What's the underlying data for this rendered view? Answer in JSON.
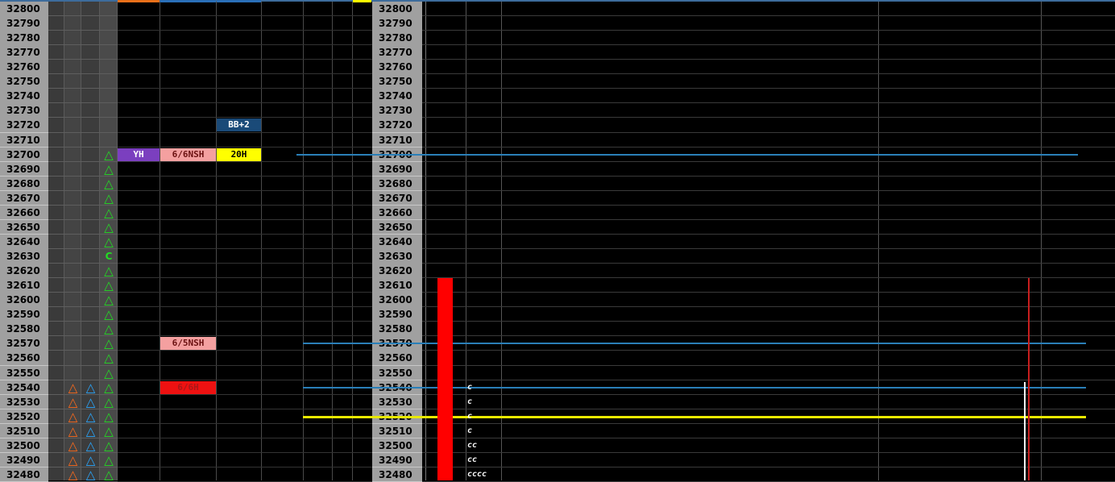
{
  "prices": [
    "32800",
    "32790",
    "32780",
    "32770",
    "32760",
    "32750",
    "32740",
    "32730",
    "32720",
    "32710",
    "32700",
    "32690",
    "32680",
    "32670",
    "32660",
    "32650",
    "32640",
    "32630",
    "32620",
    "32610",
    "32600",
    "32590",
    "32580",
    "32570",
    "32560",
    "32550",
    "32540",
    "32530",
    "32520",
    "32510",
    "32500",
    "32490",
    "32480"
  ],
  "markers": [
    {
      "price": "32700",
      "col": "green",
      "glyph": "△"
    },
    {
      "price": "32690",
      "col": "green",
      "glyph": "△"
    },
    {
      "price": "32680",
      "col": "green",
      "glyph": "△"
    },
    {
      "price": "32670",
      "col": "green",
      "glyph": "△"
    },
    {
      "price": "32660",
      "col": "green",
      "glyph": "△"
    },
    {
      "price": "32650",
      "col": "green",
      "glyph": "△"
    },
    {
      "price": "32640",
      "col": "green",
      "glyph": "△"
    },
    {
      "price": "32630",
      "col": "green",
      "glyph": "C"
    },
    {
      "price": "32620",
      "col": "green",
      "glyph": "△"
    },
    {
      "price": "32610",
      "col": "green",
      "glyph": "△"
    },
    {
      "price": "32600",
      "col": "green",
      "glyph": "△"
    },
    {
      "price": "32590",
      "col": "green",
      "glyph": "△"
    },
    {
      "price": "32580",
      "col": "green",
      "glyph": "△"
    },
    {
      "price": "32570",
      "col": "green",
      "glyph": "△"
    },
    {
      "price": "32560",
      "col": "green",
      "glyph": "△"
    },
    {
      "price": "32550",
      "col": "green",
      "glyph": "△"
    },
    {
      "price": "32540",
      "col": "green",
      "glyph": "△"
    },
    {
      "price": "32530",
      "col": "green",
      "glyph": "△"
    },
    {
      "price": "32520",
      "col": "green",
      "glyph": "△"
    },
    {
      "price": "32510",
      "col": "green",
      "glyph": "△"
    },
    {
      "price": "32500",
      "col": "green",
      "glyph": "△"
    },
    {
      "price": "32490",
      "col": "green",
      "glyph": "△"
    },
    {
      "price": "32480",
      "col": "green",
      "glyph": "△"
    },
    {
      "price": "32540",
      "col": "orange",
      "glyph": "△"
    },
    {
      "price": "32530",
      "col": "orange",
      "glyph": "△"
    },
    {
      "price": "32520",
      "col": "orange",
      "glyph": "△"
    },
    {
      "price": "32510",
      "col": "orange",
      "glyph": "△"
    },
    {
      "price": "32500",
      "col": "orange",
      "glyph": "△"
    },
    {
      "price": "32490",
      "col": "orange",
      "glyph": "△"
    },
    {
      "price": "32480",
      "col": "orange",
      "glyph": "△"
    },
    {
      "price": "32540",
      "col": "blue",
      "glyph": "△"
    },
    {
      "price": "32530",
      "col": "blue",
      "glyph": "△"
    },
    {
      "price": "32520",
      "col": "blue",
      "glyph": "△"
    },
    {
      "price": "32510",
      "col": "blue",
      "glyph": "△"
    },
    {
      "price": "32500",
      "col": "blue",
      "glyph": "△"
    },
    {
      "price": "32490",
      "col": "blue",
      "glyph": "△"
    },
    {
      "price": "32480",
      "col": "blue",
      "glyph": "△"
    }
  ],
  "marker_colors": {
    "green": "#22dd22",
    "orange": "#ff6a1a",
    "blue": "#2aa8ff"
  },
  "labels": [
    {
      "text": "BB+2",
      "price": "32720",
      "slot": "c3",
      "bg": "#1a4a78",
      "fg": "#ffffff"
    },
    {
      "text": "YH",
      "price": "32700",
      "slot": "c1",
      "bg": "#7b3fbf",
      "fg": "#ffffff"
    },
    {
      "text": "6/6NSH",
      "price": "32700",
      "slot": "c2",
      "bg": "#f4a0a0",
      "fg": "#6a1010"
    },
    {
      "text": "20H",
      "price": "32700",
      "slot": "c3",
      "bg": "#ffff00",
      "fg": "#000000"
    },
    {
      "text": "6/5NSH",
      "price": "32570",
      "slot": "c2",
      "bg": "#f4a0a0",
      "fg": "#6a1010"
    },
    {
      "text": "6/6H",
      "price": "32540",
      "slot": "c2",
      "bg": "#ee1111",
      "fg": "#aa1818"
    }
  ],
  "levels": [
    {
      "price": "32700",
      "color": "#2a7fb8",
      "span": "wide"
    },
    {
      "price": "32570",
      "color": "#2a7fb8",
      "span": "full"
    },
    {
      "price": "32540",
      "color": "#2a7fb8",
      "span": "full"
    },
    {
      "price": "32520",
      "color": "#e8e800",
      "span": "full"
    }
  ],
  "volume_bar": {
    "top_price": "32610",
    "color": "#ff0000"
  },
  "tpo_letters": [
    {
      "price": "32540",
      "text": "c"
    },
    {
      "price": "32530",
      "text": "c"
    },
    {
      "price": "32520",
      "text": "c"
    },
    {
      "price": "32510",
      "text": "c"
    },
    {
      "price": "32500",
      "text": "cc"
    },
    {
      "price": "32490",
      "text": "cc"
    },
    {
      "price": "32480",
      "text": "cccc"
    }
  ],
  "header_accents": [
    {
      "slot": "c1",
      "color": "#e8701a"
    },
    {
      "slot": "c2",
      "color": "#2a6fb8"
    },
    {
      "slot": "c3",
      "color": "#2a6fb8"
    },
    {
      "slot": "y",
      "color": "#ffff00"
    }
  ],
  "vertical_markers": [
    {
      "from_price": "32610",
      "color": "#c81e1e",
      "slot": "red"
    },
    {
      "from_price": "32540",
      "color": "#ffffff",
      "slot": "white"
    }
  ]
}
